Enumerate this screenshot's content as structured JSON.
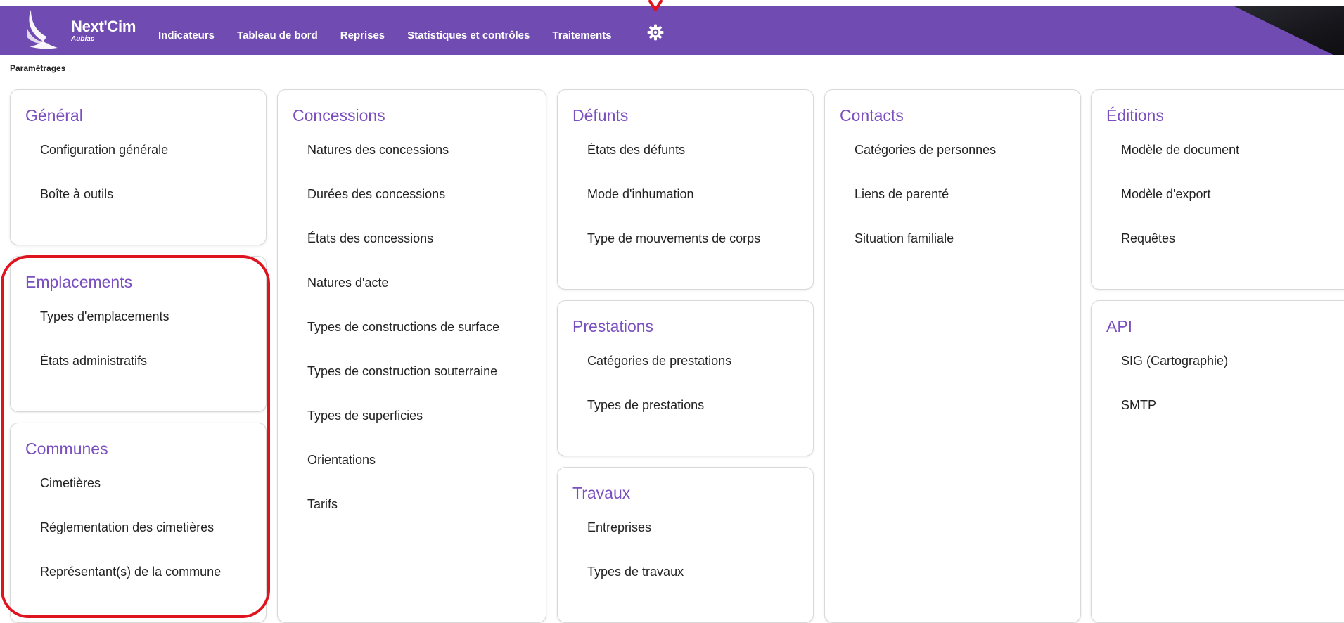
{
  "header": {
    "brand": "Next'Cim",
    "subtitle": "Aubiac",
    "nav": [
      "Indicateurs",
      "Tableau de bord",
      "Reprises",
      "Statistiques et contrôles",
      "Traitements"
    ],
    "settings_icon": "gear-icon",
    "accent_color": "#6f4bb2"
  },
  "breadcrumb": "Paramétrages",
  "sections": {
    "general": {
      "title": "Général",
      "items": [
        "Configuration générale",
        "Boîte à outils"
      ]
    },
    "emplacements": {
      "title": "Emplacements",
      "items": [
        "Types d'emplacements",
        "États administratifs"
      ]
    },
    "communes": {
      "title": "Communes",
      "items": [
        "Cimetières",
        "Réglementation des cimetières",
        "Représentant(s) de la commune"
      ]
    },
    "concessions": {
      "title": "Concessions",
      "items": [
        "Natures des concessions",
        "Durées des concessions",
        "États des concessions",
        "Natures d'acte",
        "Types de constructions de surface",
        "Types de construction souterraine",
        "Types de superficies",
        "Orientations",
        "Tarifs"
      ]
    },
    "defunts": {
      "title": "Défunts",
      "items": [
        "États des défunts",
        "Mode d'inhumation",
        "Type de mouvements de corps"
      ]
    },
    "prestations": {
      "title": "Prestations",
      "items": [
        "Catégories de prestations",
        "Types de prestations"
      ]
    },
    "travaux": {
      "title": "Travaux",
      "items": [
        "Entreprises",
        "Types de travaux"
      ]
    },
    "contacts": {
      "title": "Contacts",
      "items": [
        "Catégories de personnes",
        "Liens de parenté",
        "Situation familiale"
      ]
    },
    "editions": {
      "title": "Éditions",
      "items": [
        "Modèle de document",
        "Modèle d'export",
        "Requêtes"
      ]
    },
    "api": {
      "title": "API",
      "items": [
        "SIG (Cartographie)",
        "SMTP"
      ]
    }
  },
  "annotation_color": "#e0141e"
}
